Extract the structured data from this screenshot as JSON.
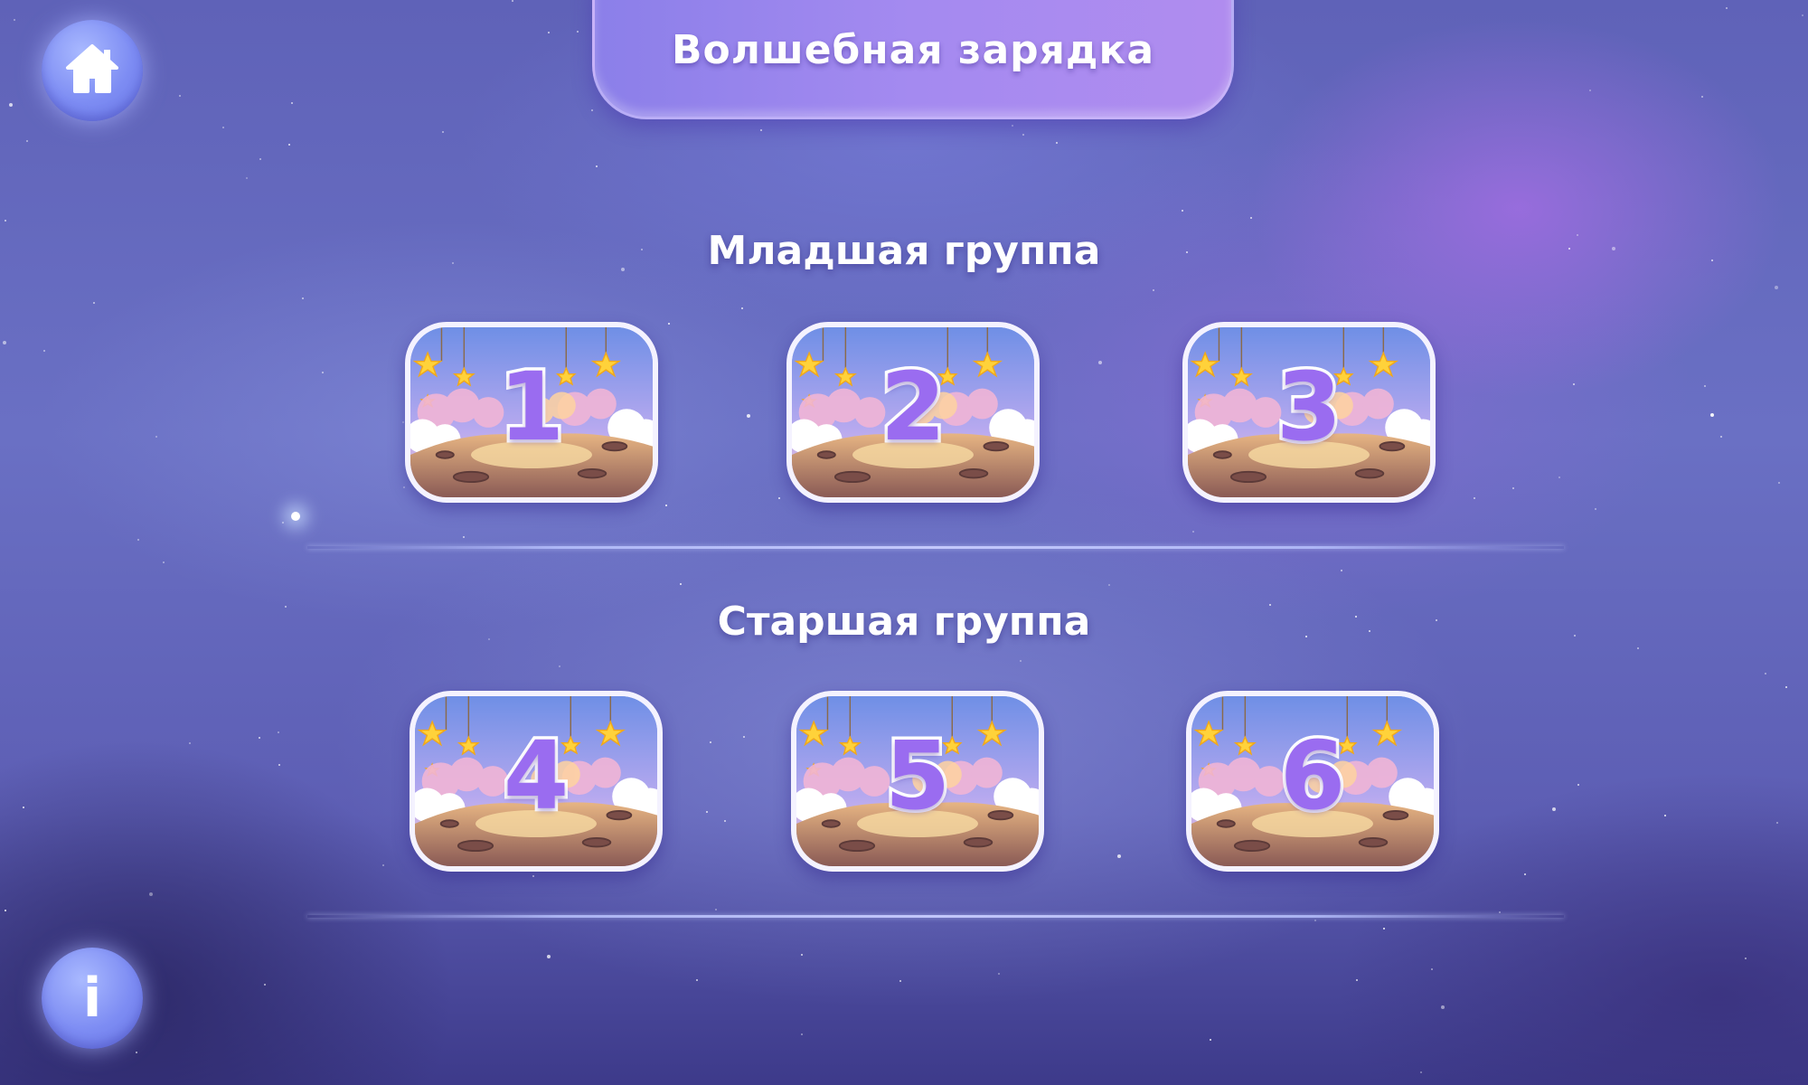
{
  "header": {
    "title": "Волшебная зарядка"
  },
  "nav": {
    "home_icon": "home-icon",
    "info_icon": "info-icon",
    "info_glyph": "i"
  },
  "sections": [
    {
      "title": "Младшая группа",
      "lessons": [
        "1",
        "2",
        "3"
      ]
    },
    {
      "title": "Старшая группа",
      "lessons": [
        "4",
        "5",
        "6"
      ]
    }
  ],
  "colors": {
    "background": "#5f62b8",
    "header": "#a48af0",
    "button": "#7d8cf3",
    "card_number": "#9a6cf0",
    "card_border": "#f4f2ff"
  }
}
